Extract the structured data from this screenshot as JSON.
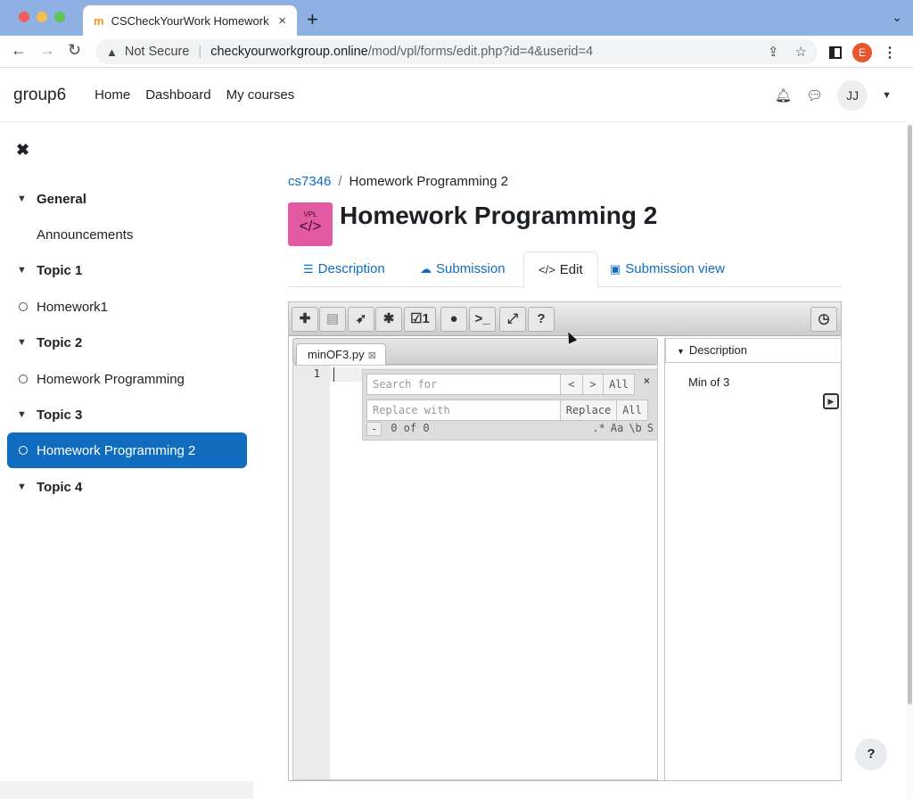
{
  "browser": {
    "tab_title": "CSCheckYourWork Homework",
    "tab_favicon": "m",
    "new_tab": "+",
    "url_warning": "Not Secure",
    "url_host": "checkyourworkgroup.online",
    "url_path": "/mod/vpl/forms/edit.php?id=4&userid=4",
    "profile_initial": "E"
  },
  "site": {
    "brand": "group6",
    "nav": [
      "Home",
      "Dashboard",
      "My courses"
    ],
    "user_initials": "JJ"
  },
  "drawer": {
    "items": [
      {
        "label": "General",
        "type": "section"
      },
      {
        "label": "Announcements",
        "type": "link"
      },
      {
        "label": "Topic 1",
        "type": "section"
      },
      {
        "label": "Homework1",
        "type": "activity"
      },
      {
        "label": "Topic 2",
        "type": "section"
      },
      {
        "label": "Homework Programming",
        "type": "activity"
      },
      {
        "label": "Topic 3",
        "type": "section"
      },
      {
        "label": "Homework Programming 2",
        "type": "activity",
        "active": true
      },
      {
        "label": "Topic 4",
        "type": "section"
      }
    ]
  },
  "breadcrumb": {
    "course": "cs7346",
    "current": "Homework Programming 2"
  },
  "page": {
    "icon_label": "VPL",
    "icon_code": "</>",
    "title": "Homework Programming 2"
  },
  "tabs": {
    "description": "Description",
    "submission": "Submission",
    "edit": "Edit",
    "submission_view": "Submission view"
  },
  "ide": {
    "file_tab": "minOF3.py",
    "line_number": "1",
    "search": {
      "placeholder": "Search for",
      "replace_placeholder": "Replace with",
      "prev": "<",
      "next": ">",
      "all": "All",
      "replace": "Replace",
      "replace_all": "All",
      "close": "×",
      "toggle": "-",
      "count": "0 of 0",
      "opt_regex": ".*",
      "opt_case": "Aa",
      "opt_word": "\\b",
      "opt_selection": "S"
    },
    "description_header": "Description",
    "description_text": "Min of 3"
  },
  "help": "?",
  "colors": {
    "accent": "#0f6cbf",
    "vpl_icon": "#e35aa2",
    "tabbar": "#8fb0e3"
  }
}
